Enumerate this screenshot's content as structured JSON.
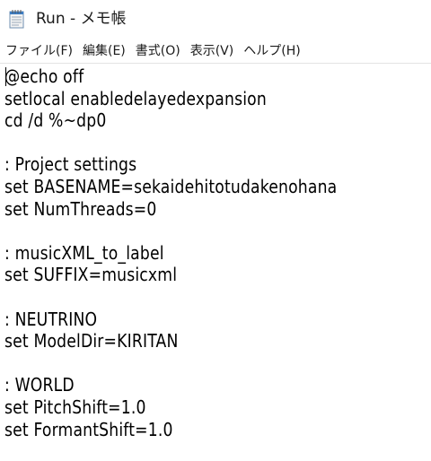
{
  "window": {
    "title": "Run - メモ帳",
    "icon": "notepad-icon"
  },
  "menu": {
    "items": [
      {
        "label": "ファイル(F)"
      },
      {
        "label": "編集(E)"
      },
      {
        "label": "書式(O)"
      },
      {
        "label": "表示(V)"
      },
      {
        "label": "ヘルプ(H)"
      }
    ]
  },
  "editor": {
    "lines": [
      "@echo off",
      "setlocal enabledelayedexpansion",
      "cd /d %~dp0",
      "",
      ": Project settings",
      "set BASENAME=sekaidehitotudakenohana",
      "set NumThreads=0",
      "",
      ": musicXML_to_label",
      "set SUFFIX=musicxml",
      "",
      ": NEUTRINO",
      "set ModelDir=KIRITAN",
      "",
      ": WORLD",
      "set PitchShift=1.0",
      "set FormantShift=1.0"
    ]
  }
}
